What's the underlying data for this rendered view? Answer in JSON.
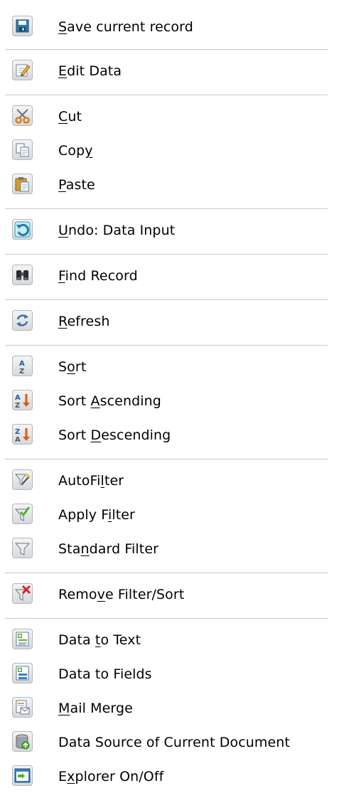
{
  "menu": {
    "items": [
      {
        "key": "save",
        "icon": "save-icon",
        "pre": "",
        "u": "S",
        "post": "ave current record"
      },
      {
        "key": "edit",
        "icon": "edit-icon",
        "pre": "",
        "u": "E",
        "post": "dit Data"
      },
      {
        "key": "cut",
        "icon": "cut-icon",
        "pre": "",
        "u": "C",
        "post": "ut"
      },
      {
        "key": "copy",
        "icon": "copy-icon",
        "pre": "Cop",
        "u": "y",
        "post": ""
      },
      {
        "key": "paste",
        "icon": "paste-icon",
        "pre": "",
        "u": "P",
        "post": "aste"
      },
      {
        "key": "undo",
        "icon": "undo-icon",
        "pre": "",
        "u": "U",
        "post": "ndo: Data Input"
      },
      {
        "key": "find",
        "icon": "binoculars-icon",
        "pre": "",
        "u": "F",
        "post": "ind Record"
      },
      {
        "key": "refresh",
        "icon": "refresh-icon",
        "pre": "",
        "u": "R",
        "post": "efresh"
      },
      {
        "key": "sort",
        "icon": "sort-icon",
        "pre": "S",
        "u": "o",
        "post": "rt"
      },
      {
        "key": "sort-ascending",
        "icon": "sort-ascending-icon",
        "pre": "Sort ",
        "u": "A",
        "post": "scending"
      },
      {
        "key": "sort-descending",
        "icon": "sort-descending-icon",
        "pre": "Sort ",
        "u": "D",
        "post": "escending"
      },
      {
        "key": "autofilter",
        "icon": "autofilter-icon",
        "pre": "AutoFi",
        "u": "l",
        "post": "ter"
      },
      {
        "key": "apply-filter",
        "icon": "apply-filter-icon",
        "pre": "Apply F",
        "u": "i",
        "post": "lter"
      },
      {
        "key": "standard-filter",
        "icon": "standard-filter-icon",
        "pre": "Sta",
        "u": "n",
        "post": "dard Filter"
      },
      {
        "key": "remove-filter",
        "icon": "remove-filter-icon",
        "pre": "Remo",
        "u": "v",
        "post": "e Filter/Sort"
      },
      {
        "key": "data-to-text",
        "icon": "data-to-text-icon",
        "pre": "Data ",
        "u": "t",
        "post": "o Text"
      },
      {
        "key": "data-to-fields",
        "icon": "data-to-fields-icon",
        "pre": "Data to Fields",
        "u": "",
        "post": ""
      },
      {
        "key": "mail-merge",
        "icon": "mail-merge-icon",
        "pre": "",
        "u": "M",
        "post": "ail Merge"
      },
      {
        "key": "data-source",
        "icon": "database-icon",
        "pre": "Data Source of Current Document",
        "u": "",
        "post": ""
      },
      {
        "key": "explorer",
        "icon": "explorer-icon",
        "pre": "E",
        "u": "x",
        "post": "plorer On/Off"
      }
    ]
  }
}
